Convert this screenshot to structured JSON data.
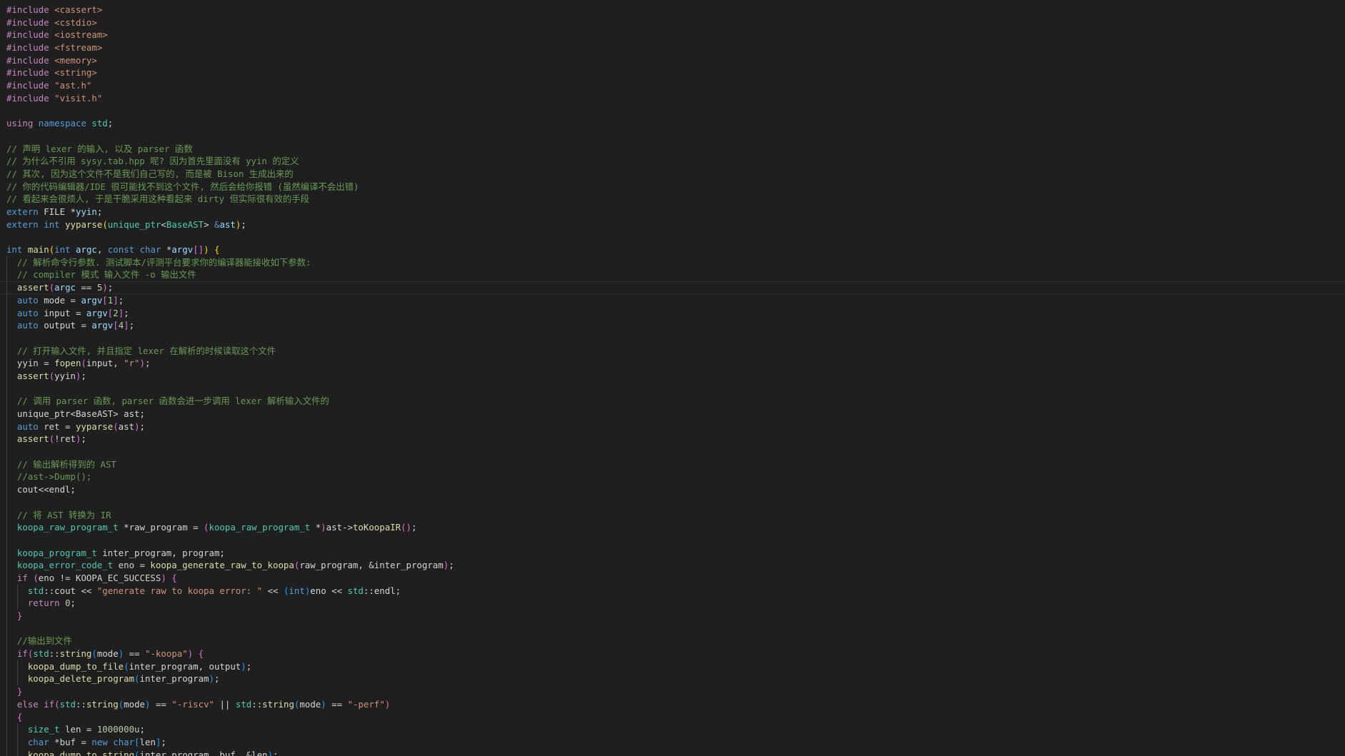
{
  "editor": {
    "theme": {
      "background": "#1f1f1f",
      "default": "#d4d4d4",
      "keyword": "#569cd6",
      "control": "#c586c0",
      "type": "#4ec9b0",
      "function": "#dcdcaa",
      "variable": "#9cdcfe",
      "string": "#ce9178",
      "number": "#b5cea8",
      "comment": "#6a9955",
      "macro": "#4fc1ff",
      "brace1": "#ffd700",
      "brace2": "#da70d6",
      "brace3": "#179fff"
    },
    "current_line": 22,
    "lines": [
      [
        [
          "control",
          "#include"
        ],
        [
          "default",
          " "
        ],
        [
          "string",
          "<cassert>"
        ]
      ],
      [
        [
          "control",
          "#include"
        ],
        [
          "default",
          " "
        ],
        [
          "string",
          "<cstdio>"
        ]
      ],
      [
        [
          "control",
          "#include"
        ],
        [
          "default",
          " "
        ],
        [
          "string",
          "<iostream>"
        ]
      ],
      [
        [
          "control",
          "#include"
        ],
        [
          "default",
          " "
        ],
        [
          "string",
          "<fstream>"
        ]
      ],
      [
        [
          "control",
          "#include"
        ],
        [
          "default",
          " "
        ],
        [
          "string",
          "<memory>"
        ]
      ],
      [
        [
          "control",
          "#include"
        ],
        [
          "default",
          " "
        ],
        [
          "string",
          "<string>"
        ]
      ],
      [
        [
          "control",
          "#include"
        ],
        [
          "default",
          " "
        ],
        [
          "string",
          "\"ast.h\""
        ]
      ],
      [
        [
          "control",
          "#include"
        ],
        [
          "default",
          " "
        ],
        [
          "string",
          "\"visit.h\""
        ]
      ],
      [],
      [
        [
          "control",
          "using"
        ],
        [
          "default",
          " "
        ],
        [
          "keyword",
          "namespace"
        ],
        [
          "default",
          " "
        ],
        [
          "type",
          "std"
        ],
        [
          "default",
          ";"
        ]
      ],
      [],
      [
        [
          "comment",
          "// 声明 lexer 的输入, 以及 parser 函数"
        ]
      ],
      [
        [
          "comment",
          "// 为什么不引用 sysy.tab.hpp 呢? 因为首先里面没有 yyin 的定义"
        ]
      ],
      [
        [
          "comment",
          "// 其次, 因为这个文件不是我们自己写的, 而是被 Bison 生成出来的"
        ]
      ],
      [
        [
          "comment",
          "// 你的代码编辑器/IDE 很可能找不到这个文件, 然后会给你报错 (虽然编译不会出错)"
        ]
      ],
      [
        [
          "comment",
          "// 看起来会很烦人, 于是干脆采用这种看起来 dirty 但实际很有效的手段"
        ]
      ],
      [
        [
          "keyword",
          "extern"
        ],
        [
          "default",
          " FILE "
        ],
        [
          "default",
          "*"
        ],
        [
          "variable",
          "yyin"
        ],
        [
          "default",
          ";"
        ]
      ],
      [
        [
          "keyword",
          "extern"
        ],
        [
          "default",
          " "
        ],
        [
          "keyword",
          "int"
        ],
        [
          "default",
          " "
        ],
        [
          "function",
          "yyparse"
        ],
        [
          "brace1",
          "("
        ],
        [
          "type",
          "unique_ptr"
        ],
        [
          "default",
          "<"
        ],
        [
          "type",
          "BaseAST"
        ],
        [
          "default",
          "> "
        ],
        [
          "keyword",
          "&"
        ],
        [
          "variable",
          "ast"
        ],
        [
          "brace1",
          ")"
        ],
        [
          "default",
          ";"
        ]
      ],
      [],
      [
        [
          "keyword",
          "int"
        ],
        [
          "default",
          " "
        ],
        [
          "function",
          "main"
        ],
        [
          "brace1",
          "("
        ],
        [
          "keyword",
          "int"
        ],
        [
          "default",
          " "
        ],
        [
          "variable",
          "argc"
        ],
        [
          "default",
          ", "
        ],
        [
          "keyword",
          "const"
        ],
        [
          "default",
          " "
        ],
        [
          "keyword",
          "char"
        ],
        [
          "default",
          " *"
        ],
        [
          "variable",
          "argv"
        ],
        [
          "brace2",
          "[]"
        ],
        [
          "brace1",
          ")"
        ],
        [
          "default",
          " "
        ],
        [
          "brace1",
          "{"
        ]
      ],
      [
        [
          "default",
          "  "
        ],
        [
          "comment",
          "// 解析命令行参数. 测试脚本/评测平台要求你的编译器能接收如下参数:"
        ]
      ],
      [
        [
          "default",
          "  "
        ],
        [
          "comment",
          "// compiler 模式 输入文件 -o 输出文件"
        ]
      ],
      [
        [
          "default",
          "  "
        ],
        [
          "function",
          "assert"
        ],
        [
          "brace2",
          "("
        ],
        [
          "variable",
          "argc"
        ],
        [
          "default",
          " == "
        ],
        [
          "number",
          "5"
        ],
        [
          "brace2",
          ")"
        ],
        [
          "default",
          ";"
        ]
      ],
      [
        [
          "default",
          "  "
        ],
        [
          "keyword",
          "auto"
        ],
        [
          "default",
          " mode = "
        ],
        [
          "variable",
          "argv"
        ],
        [
          "brace2",
          "["
        ],
        [
          "number",
          "1"
        ],
        [
          "brace2",
          "]"
        ],
        [
          "default",
          ";"
        ]
      ],
      [
        [
          "default",
          "  "
        ],
        [
          "keyword",
          "auto"
        ],
        [
          "default",
          " input = "
        ],
        [
          "variable",
          "argv"
        ],
        [
          "brace2",
          "["
        ],
        [
          "number",
          "2"
        ],
        [
          "brace2",
          "]"
        ],
        [
          "default",
          ";"
        ]
      ],
      [
        [
          "default",
          "  "
        ],
        [
          "keyword",
          "auto"
        ],
        [
          "default",
          " output = "
        ],
        [
          "variable",
          "argv"
        ],
        [
          "brace2",
          "["
        ],
        [
          "number",
          "4"
        ],
        [
          "brace2",
          "]"
        ],
        [
          "default",
          ";"
        ]
      ],
      [],
      [
        [
          "default",
          "  "
        ],
        [
          "comment",
          "// 打开输入文件, 并且指定 lexer 在解析的时候读取这个文件"
        ]
      ],
      [
        [
          "default",
          "  yyin = "
        ],
        [
          "function",
          "fopen"
        ],
        [
          "brace2",
          "("
        ],
        [
          "default",
          "input, "
        ],
        [
          "string",
          "\"r\""
        ],
        [
          "brace2",
          ")"
        ],
        [
          "default",
          ";"
        ]
      ],
      [
        [
          "default",
          "  "
        ],
        [
          "function",
          "assert"
        ],
        [
          "brace2",
          "("
        ],
        [
          "default",
          "yyin"
        ],
        [
          "brace2",
          ")"
        ],
        [
          "default",
          ";"
        ]
      ],
      [],
      [
        [
          "default",
          "  "
        ],
        [
          "comment",
          "// 调用 parser 函数, parser 函数会进一步调用 lexer 解析输入文件的"
        ]
      ],
      [
        [
          "default",
          "  unique_ptr<BaseAST> ast;"
        ]
      ],
      [
        [
          "default",
          "  "
        ],
        [
          "keyword",
          "auto"
        ],
        [
          "default",
          " ret = "
        ],
        [
          "function",
          "yyparse"
        ],
        [
          "brace2",
          "("
        ],
        [
          "default",
          "ast"
        ],
        [
          "brace2",
          ")"
        ],
        [
          "default",
          ";"
        ]
      ],
      [
        [
          "default",
          "  "
        ],
        [
          "function",
          "assert"
        ],
        [
          "brace2",
          "("
        ],
        [
          "default",
          "!ret"
        ],
        [
          "brace2",
          ")"
        ],
        [
          "default",
          ";"
        ]
      ],
      [],
      [
        [
          "default",
          "  "
        ],
        [
          "comment",
          "// 输出解析得到的 AST"
        ]
      ],
      [
        [
          "default",
          "  "
        ],
        [
          "comment",
          "//ast->Dump();"
        ]
      ],
      [
        [
          "default",
          "  cout<<endl;"
        ]
      ],
      [],
      [
        [
          "default",
          "  "
        ],
        [
          "comment",
          "// 将 AST 转换为 IR"
        ]
      ],
      [
        [
          "default",
          "  "
        ],
        [
          "type",
          "koopa_raw_program_t"
        ],
        [
          "default",
          " *raw_program = "
        ],
        [
          "brace2",
          "("
        ],
        [
          "type",
          "koopa_raw_program_t"
        ],
        [
          "default",
          " *"
        ],
        [
          "brace2",
          ")"
        ],
        [
          "default",
          "ast->"
        ],
        [
          "function",
          "toKoopaIR"
        ],
        [
          "brace2",
          "()"
        ],
        [
          "default",
          ";"
        ]
      ],
      [],
      [
        [
          "default",
          "  "
        ],
        [
          "type",
          "koopa_program_t"
        ],
        [
          "default",
          " inter_program, program;"
        ]
      ],
      [
        [
          "default",
          "  "
        ],
        [
          "type",
          "koopa_error_code_t"
        ],
        [
          "default",
          " eno = "
        ],
        [
          "function",
          "koopa_generate_raw_to_koopa"
        ],
        [
          "brace2",
          "("
        ],
        [
          "default",
          "raw_program, &inter_program"
        ],
        [
          "brace2",
          ")"
        ],
        [
          "default",
          ";"
        ]
      ],
      [
        [
          "default",
          "  "
        ],
        [
          "control",
          "if"
        ],
        [
          "default",
          " "
        ],
        [
          "brace2",
          "("
        ],
        [
          "default",
          "eno != KOOPA_EC_SUCCESS"
        ],
        [
          "brace2",
          ")"
        ],
        [
          "default",
          " "
        ],
        [
          "brace2",
          "{"
        ]
      ],
      [
        [
          "default",
          "    "
        ],
        [
          "type",
          "std"
        ],
        [
          "default",
          "::cout << "
        ],
        [
          "string",
          "\"generate raw to koopa error: \""
        ],
        [
          "default",
          " << "
        ],
        [
          "brace3",
          "("
        ],
        [
          "keyword",
          "int"
        ],
        [
          "brace3",
          ")"
        ],
        [
          "default",
          "eno << "
        ],
        [
          "type",
          "std"
        ],
        [
          "default",
          "::endl;"
        ]
      ],
      [
        [
          "default",
          "    "
        ],
        [
          "control",
          "return"
        ],
        [
          "default",
          " "
        ],
        [
          "number",
          "0"
        ],
        [
          "default",
          ";"
        ]
      ],
      [
        [
          "default",
          "  "
        ],
        [
          "brace2",
          "}"
        ]
      ],
      [],
      [
        [
          "default",
          "  "
        ],
        [
          "comment",
          "//输出到文件"
        ]
      ],
      [
        [
          "default",
          "  "
        ],
        [
          "control",
          "if"
        ],
        [
          "brace2",
          "("
        ],
        [
          "type",
          "std"
        ],
        [
          "default",
          "::"
        ],
        [
          "function",
          "string"
        ],
        [
          "brace3",
          "("
        ],
        [
          "default",
          "mode"
        ],
        [
          "brace3",
          ")"
        ],
        [
          "default",
          " == "
        ],
        [
          "string",
          "\"-koopa\""
        ],
        [
          "brace2",
          ")"
        ],
        [
          "default",
          " "
        ],
        [
          "brace2",
          "{"
        ]
      ],
      [
        [
          "default",
          "    "
        ],
        [
          "function",
          "koopa_dump_to_file"
        ],
        [
          "brace3",
          "("
        ],
        [
          "default",
          "inter_program, output"
        ],
        [
          "brace3",
          ")"
        ],
        [
          "default",
          ";"
        ]
      ],
      [
        [
          "default",
          "    "
        ],
        [
          "function",
          "koopa_delete_program"
        ],
        [
          "brace3",
          "("
        ],
        [
          "default",
          "inter_program"
        ],
        [
          "brace3",
          ")"
        ],
        [
          "default",
          ";"
        ]
      ],
      [
        [
          "default",
          "  "
        ],
        [
          "brace2",
          "}"
        ]
      ],
      [
        [
          "default",
          "  "
        ],
        [
          "control",
          "else"
        ],
        [
          "default",
          " "
        ],
        [
          "control",
          "if"
        ],
        [
          "brace2",
          "("
        ],
        [
          "type",
          "std"
        ],
        [
          "default",
          "::"
        ],
        [
          "function",
          "string"
        ],
        [
          "brace3",
          "("
        ],
        [
          "default",
          "mode"
        ],
        [
          "brace3",
          ")"
        ],
        [
          "default",
          " == "
        ],
        [
          "string",
          "\"-riscv\""
        ],
        [
          "default",
          " || "
        ],
        [
          "type",
          "std"
        ],
        [
          "default",
          "::"
        ],
        [
          "function",
          "string"
        ],
        [
          "brace3",
          "("
        ],
        [
          "default",
          "mode"
        ],
        [
          "brace3",
          ")"
        ],
        [
          "default",
          " == "
        ],
        [
          "string",
          "\"-perf\""
        ],
        [
          "brace2",
          ")"
        ]
      ],
      [
        [
          "default",
          "  "
        ],
        [
          "brace2",
          "{"
        ]
      ],
      [
        [
          "default",
          "    "
        ],
        [
          "type",
          "size_t"
        ],
        [
          "default",
          " len = "
        ],
        [
          "number",
          "1000000u"
        ],
        [
          "default",
          ";"
        ]
      ],
      [
        [
          "default",
          "    "
        ],
        [
          "keyword",
          "char"
        ],
        [
          "default",
          " *buf = "
        ],
        [
          "keyword",
          "new"
        ],
        [
          "default",
          " "
        ],
        [
          "keyword",
          "char"
        ],
        [
          "brace3",
          "["
        ],
        [
          "default",
          "len"
        ],
        [
          "brace3",
          "]"
        ],
        [
          "default",
          ";"
        ]
      ],
      [
        [
          "default",
          "    "
        ],
        [
          "function",
          "koopa_dump_to_string"
        ],
        [
          "brace3",
          "("
        ],
        [
          "default",
          "inter_program, buf, &len"
        ],
        [
          "brace3",
          ")"
        ],
        [
          "default",
          ";"
        ]
      ]
    ]
  }
}
